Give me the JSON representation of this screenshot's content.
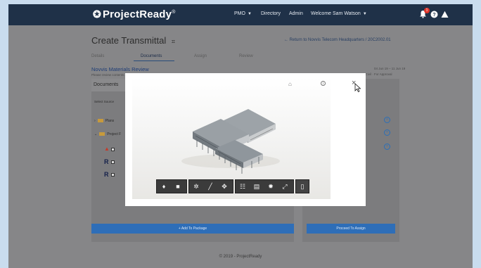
{
  "header": {
    "logo": "ProjectReady",
    "logo_mark": "®",
    "nav": [
      {
        "label": "PMO",
        "dropdown": true
      },
      {
        "label": "Directory",
        "dropdown": false
      },
      {
        "label": "Admin",
        "dropdown": false
      },
      {
        "label": "Welcome Sam Watson",
        "dropdown": true
      }
    ],
    "notification_count": "1",
    "icons": [
      "bell-icon",
      "help-icon",
      "warning-icon"
    ]
  },
  "page": {
    "title": "Create Transmittal",
    "return_link": "← Return to Novvis Telecom Headquarters / 20C2002.01",
    "tabs": [
      "Details",
      "Documents",
      "Assign",
      "Review"
    ],
    "active_tab": "Documents",
    "package_name": "Novvis Materials Review",
    "package_subtitle": "Please review contents and approve for use",
    "package_meta_dates": "04 Jun 19 – 11 Jun 19",
    "package_meta_status": "CT-001 · C-Civil · For Approval",
    "documents_header": "Documents",
    "select_source": "Select Source",
    "tree": [
      {
        "label": "Plans",
        "expanded": false
      },
      {
        "label": "Project F",
        "expanded": true
      }
    ],
    "add_button": "+ Add To Package",
    "proceed_button": "Proceed To Assign",
    "footer": "© 2019 - ProjectReady"
  },
  "modal": {
    "toolbar_icons": [
      "walk-icon",
      "camera-icon",
      "orbit-icon",
      "measure-icon",
      "explode-icon",
      "model-tree-icon",
      "properties-icon",
      "settings-icon",
      "fullscreen-icon",
      "document-icon"
    ]
  },
  "colors": {
    "header_bg": "#1f3148",
    "accent_blue": "#2e6eb8",
    "link_blue": "#1d3c76",
    "badge_red": "#e0352a"
  }
}
